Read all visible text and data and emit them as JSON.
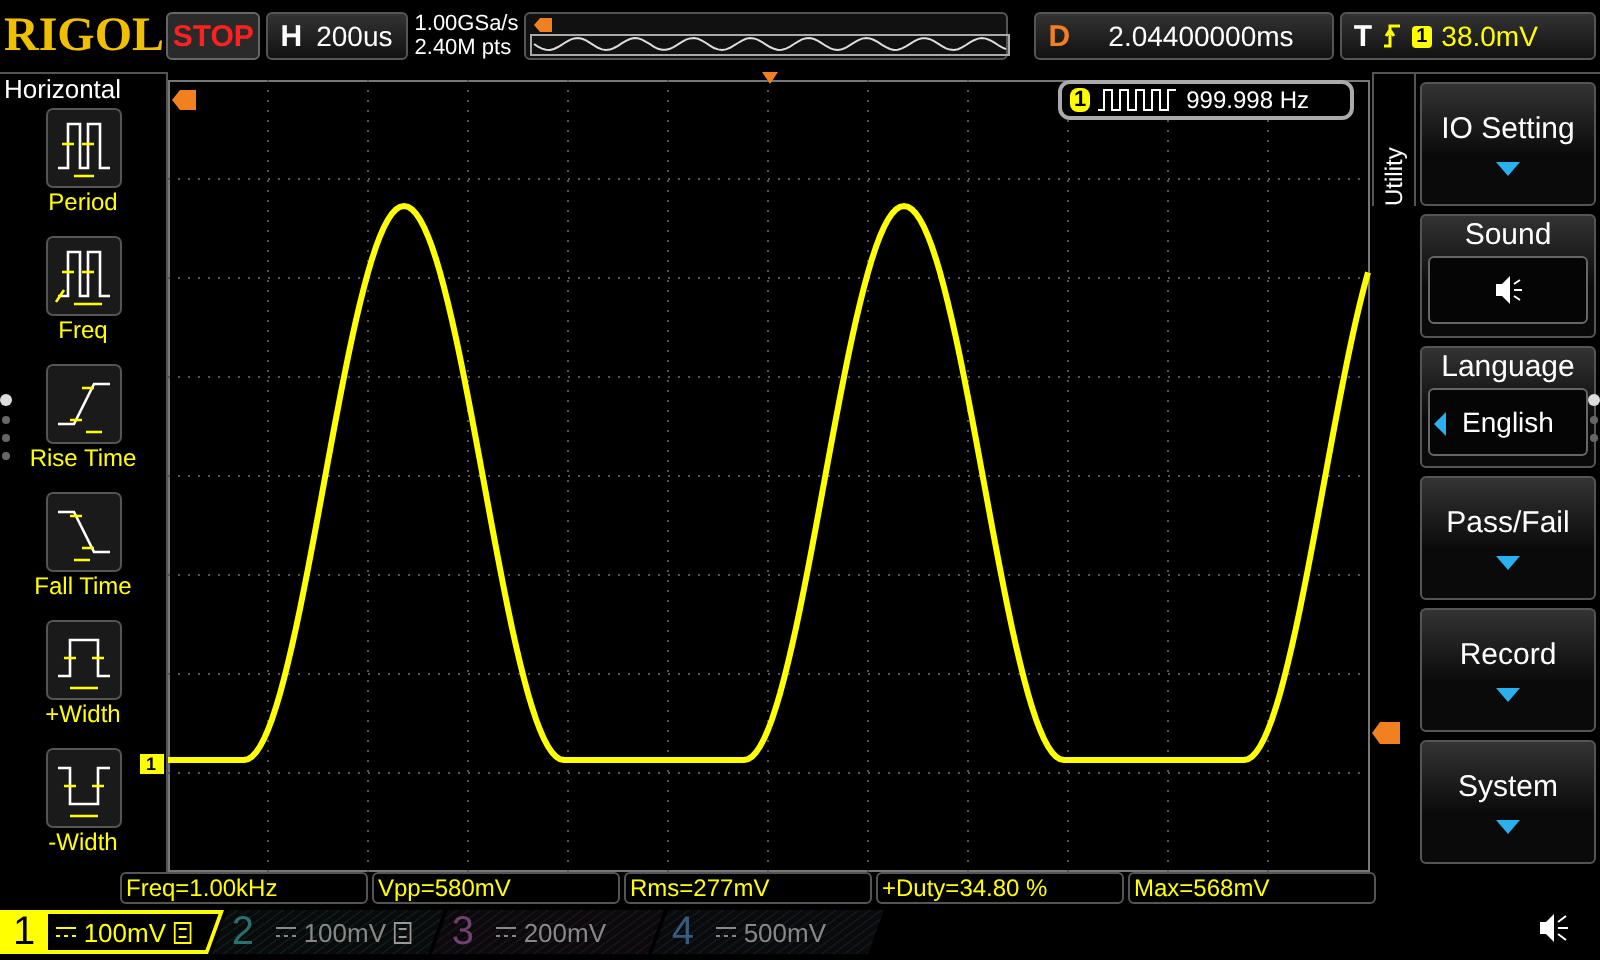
{
  "header": {
    "brand": "RIGOL",
    "run_state": "STOP",
    "timebase_label": "H",
    "timebase": "200us",
    "sample_rate": "1.00GSa/s",
    "memory_depth": "2.40M pts",
    "delay_label": "D",
    "delay": "2.04400000ms",
    "trigger_label": "T",
    "trigger_source": "1",
    "trigger_level": "38.0mV"
  },
  "left_menu": {
    "title": "Horizontal",
    "items": [
      {
        "label": "Period",
        "kind": "period"
      },
      {
        "label": "Freq",
        "kind": "freq"
      },
      {
        "label": "Rise Time",
        "kind": "rise"
      },
      {
        "label": "Fall Time",
        "kind": "fall"
      },
      {
        "label": "+Width",
        "kind": "pwidth"
      },
      {
        "label": "-Width",
        "kind": "nwidth"
      }
    ],
    "page_dots": [
      {
        "selected": true
      },
      {
        "selected": false
      },
      {
        "selected": false
      },
      {
        "selected": false
      }
    ]
  },
  "display": {
    "channel_marker": "1",
    "frequency_badge": {
      "channel": "1",
      "value": "999.998 Hz"
    }
  },
  "right_menu": {
    "title": "Utility",
    "items": [
      {
        "label": "IO Setting",
        "kind": "submenu"
      },
      {
        "label": "Sound",
        "kind": "sound",
        "on": true
      },
      {
        "label": "Language",
        "kind": "value",
        "value": "English"
      },
      {
        "label": "Pass/Fail",
        "kind": "submenu"
      },
      {
        "label": "Record",
        "kind": "submenu"
      },
      {
        "label": "System",
        "kind": "submenu"
      }
    ],
    "page_dots": [
      {
        "selected": true
      },
      {
        "selected": false
      },
      {
        "selected": false
      }
    ]
  },
  "measurements": [
    "Freq=1.00kHz",
    "Vpp=580mV",
    "Rms=277mV",
    "+Duty=34.80 %",
    "Max=568mV"
  ],
  "channels": [
    {
      "number": "1",
      "scale": "100mV",
      "selected": true,
      "bw_limit": true,
      "color": "#ffff00"
    },
    {
      "number": "2",
      "scale": "100mV",
      "selected": false,
      "bw_limit": true,
      "color": "#2a7070"
    },
    {
      "number": "3",
      "scale": "200mV",
      "selected": false,
      "bw_limit": false,
      "color": "#704070"
    },
    {
      "number": "4",
      "scale": "500mV",
      "selected": false,
      "bw_limit": false,
      "color": "#3a5a80"
    }
  ]
}
